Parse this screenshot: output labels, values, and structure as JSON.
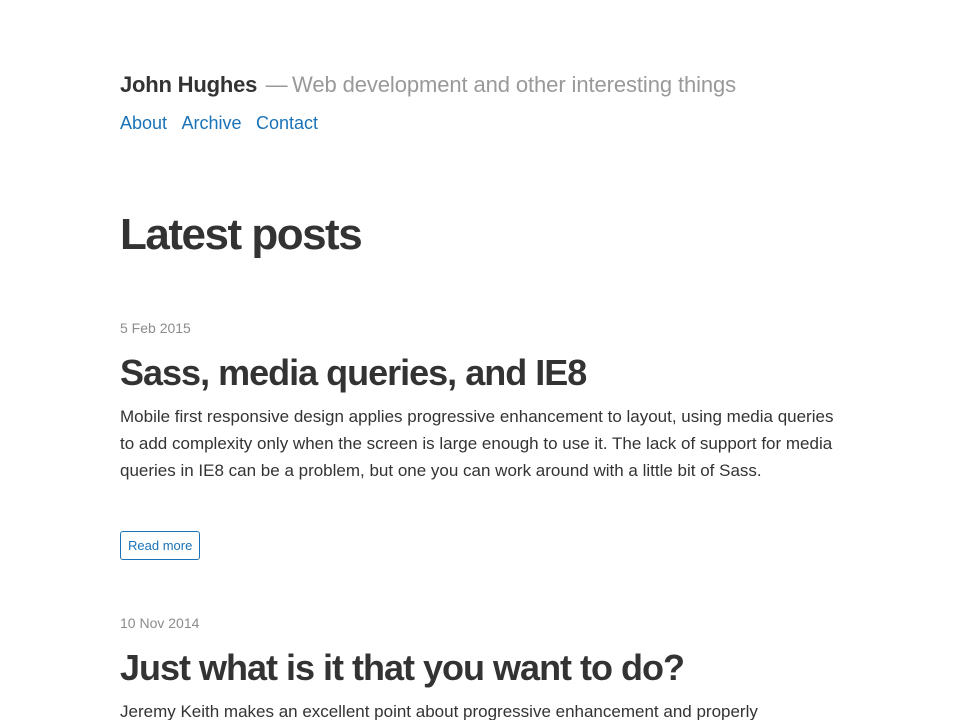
{
  "header": {
    "site_title": "John Hughes",
    "separator": "—",
    "tagline": "Web development and other interesting things"
  },
  "nav": {
    "items": [
      {
        "label": "About"
      },
      {
        "label": "Archive"
      },
      {
        "label": "Contact"
      }
    ]
  },
  "main": {
    "heading": "Latest posts",
    "posts": [
      {
        "date": "5 Feb 2015",
        "title": "Sass, media queries, and IE8",
        "excerpt": "Mobile first responsive design applies progressive enhancement to layout, using media queries to add complexity only when the screen is large enough to use it. The lack of support for media queries in IE8 can be a problem, but one you can work around with a little bit of Sass.",
        "read_more": "Read more"
      },
      {
        "date": "10 Nov 2014",
        "title": "Just what is it that you want to do?",
        "excerpt": "Jeremy Keith makes an excellent point about progressive enhancement and properly"
      }
    ]
  },
  "colors": {
    "text": "#333333",
    "muted": "#999999",
    "link": "#1a73b8"
  }
}
